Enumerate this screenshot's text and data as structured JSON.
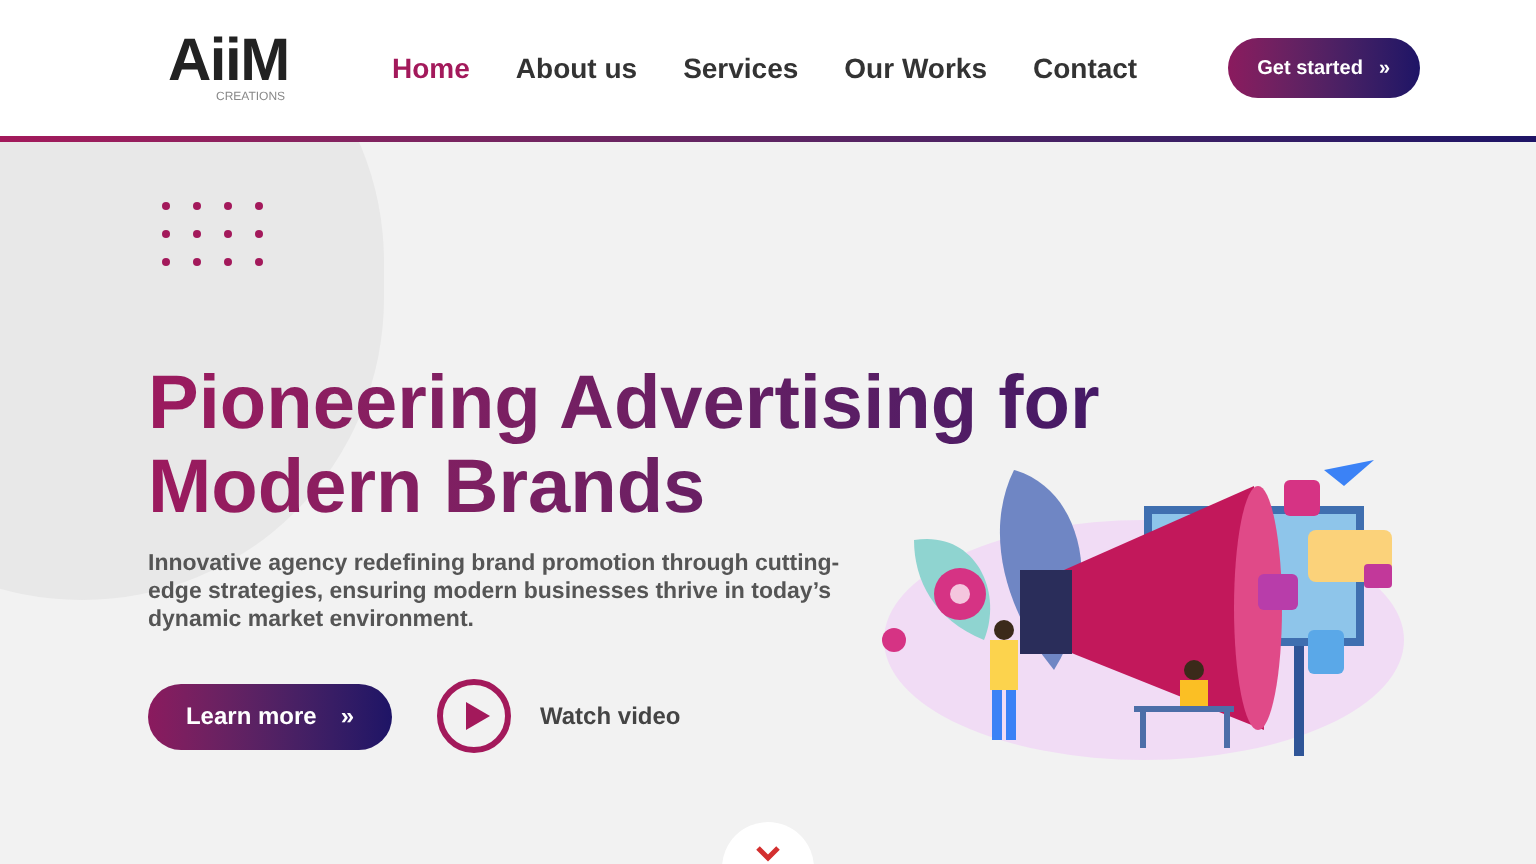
{
  "logo": {
    "mark": "AiiM",
    "tagline": "CREATIONS"
  },
  "nav": [
    {
      "label": "Home",
      "selected": true
    },
    {
      "label": "About us",
      "selected": false
    },
    {
      "label": "Services",
      "selected": false
    },
    {
      "label": "Our Works",
      "selected": false
    },
    {
      "label": "Contact",
      "selected": false
    }
  ],
  "cta": {
    "label": "Get started",
    "icon": "»"
  },
  "hero": {
    "title_lines": [
      "Pioneering Advertising for",
      "Modern Brands"
    ],
    "description": "Innovative agency redefining brand promotion through cutting-edge strategies, ensuring modern businesses thrive in today’s dynamic market environment.",
    "primary_button": {
      "label": "Learn more",
      "icon": "»"
    },
    "video_link": {
      "label": "Watch video"
    }
  }
}
